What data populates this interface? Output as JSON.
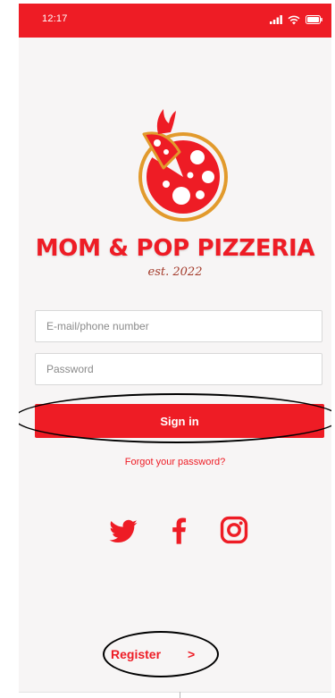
{
  "status_bar": {
    "time": "12:17",
    "signal_icon": "signal-icon",
    "wifi_icon": "wifi-icon",
    "battery_icon": "battery-icon"
  },
  "brand": {
    "logo_icon": "pizza-logo-icon",
    "name": "MOM & POP PIZZERIA",
    "established": "est. 2022"
  },
  "login_form": {
    "email_placeholder": "E-mail/phone number",
    "email_value": "",
    "password_placeholder": "Password",
    "password_value": "",
    "signin_label": "Sign in",
    "forgot_label": "Forgot your password?"
  },
  "social": [
    {
      "name": "twitter",
      "icon": "twitter-icon"
    },
    {
      "name": "facebook",
      "icon": "facebook-icon"
    },
    {
      "name": "instagram",
      "icon": "instagram-icon"
    }
  ],
  "footer": {
    "register_label": "Register",
    "register_chevron": ">"
  },
  "colors": {
    "brand_red": "#ee1c25",
    "background": "#f7f5f5",
    "field_border": "#d8d8d8",
    "annotation_ring": "#000000"
  }
}
